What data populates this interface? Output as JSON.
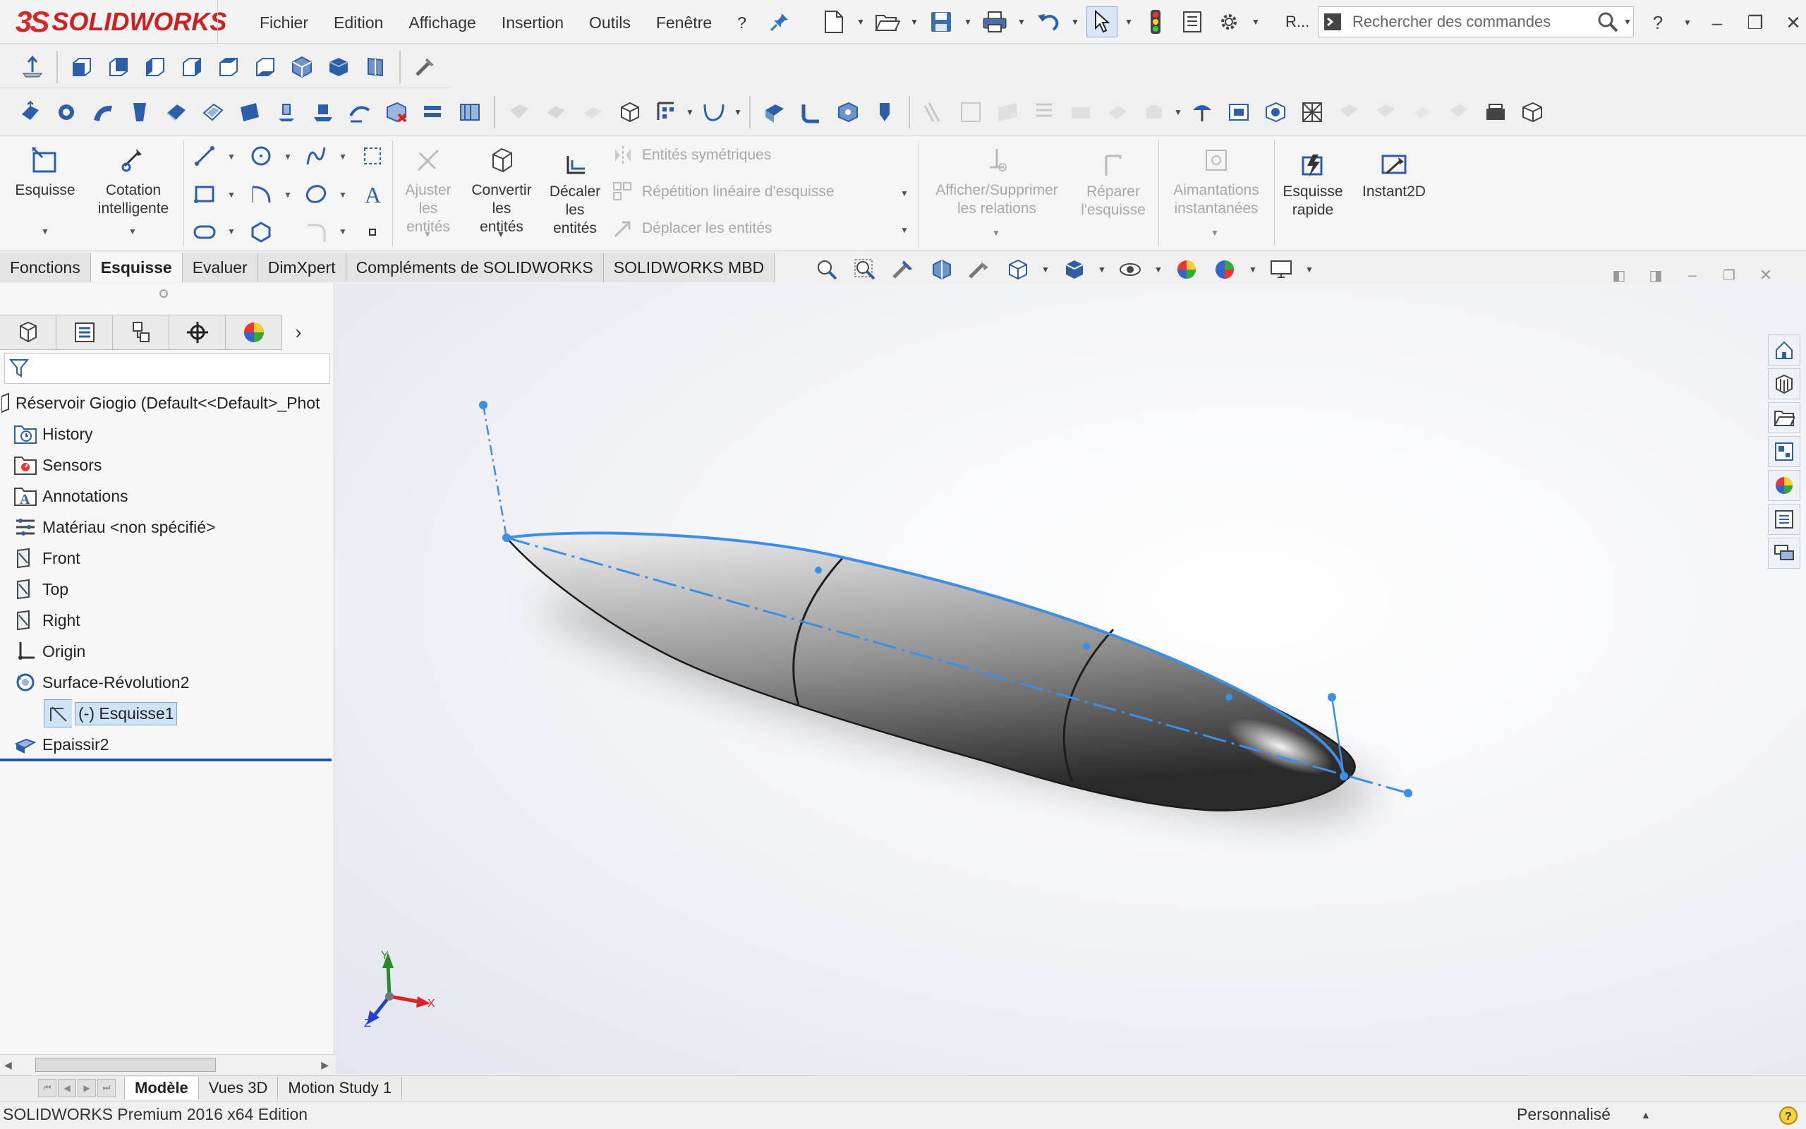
{
  "app": {
    "brand_ds": "3S",
    "brand_name": "SOLIDWORKS"
  },
  "menu": [
    "Fichier",
    "Edition",
    "Affichage",
    "Insertion",
    "Outils",
    "Fenêtre",
    "?"
  ],
  "quick": {
    "r_label": "R...",
    "search_placeholder": "Rechercher des commandes"
  },
  "command_manager": {
    "esquisse": "Esquisse",
    "cotation": [
      "Cotation",
      "intelligente"
    ],
    "ajuster": [
      "Ajuster",
      "les",
      "entités"
    ],
    "convertir": [
      "Convertir",
      "les",
      "entités"
    ],
    "decaler": [
      "Décaler",
      "les",
      "entités"
    ],
    "entites_symetriques": "Entités symétriques",
    "repetition": "Répétition linéaire d'esquisse",
    "deplacer": "Déplacer les entités",
    "afficher": [
      "Afficher/Supprimer",
      "les relations"
    ],
    "reparer": [
      "Réparer",
      "l'esquisse"
    ],
    "aimantations": [
      "Aimantations",
      "instantanées"
    ],
    "esquisse_rapide": [
      "Esquisse",
      "rapide"
    ],
    "instant2d": "Instant2D"
  },
  "cm_tabs": [
    "Fonctions",
    "Esquisse",
    "Evaluer",
    "DimXpert",
    "Compléments de SOLIDWORKS",
    "SOLIDWORKS MBD"
  ],
  "cm_active_tab": "Esquisse",
  "feature_tree": {
    "root": "Réservoir Giogio  (Default<<Default>_Phot",
    "items": [
      {
        "label": "History",
        "icon": "history-folder-icon"
      },
      {
        "label": "Sensors",
        "icon": "sensors-icon"
      },
      {
        "label": "Annotations",
        "icon": "annotations-icon"
      },
      {
        "label": "Matériau <non spécifié>",
        "icon": "material-icon"
      },
      {
        "label": "Front",
        "icon": "plane-icon"
      },
      {
        "label": "Top",
        "icon": "plane-icon"
      },
      {
        "label": "Right",
        "icon": "plane-icon"
      },
      {
        "label": "Origin",
        "icon": "origin-icon"
      },
      {
        "label": "Surface-Révolution2",
        "icon": "surface-revolve-icon"
      },
      {
        "label": "(-) Esquisse1",
        "icon": "sketch-icon",
        "selected": true
      },
      {
        "label": "Epaissir2",
        "icon": "thicken-icon"
      }
    ]
  },
  "triad": {
    "x": "X",
    "y": "Y",
    "z": "Z"
  },
  "bottom_tabs": [
    "Modèle",
    "Vues 3D",
    "Motion Study 1"
  ],
  "bottom_active_tab": "Modèle",
  "status": {
    "text": "SOLIDWORKS Premium 2016 x64 Edition",
    "units": "Personnalisé"
  },
  "colors": {
    "sketch_blue": "#3b8fe8",
    "selection_blue": "#1c58a8",
    "brand_red": "#d42a2a"
  }
}
